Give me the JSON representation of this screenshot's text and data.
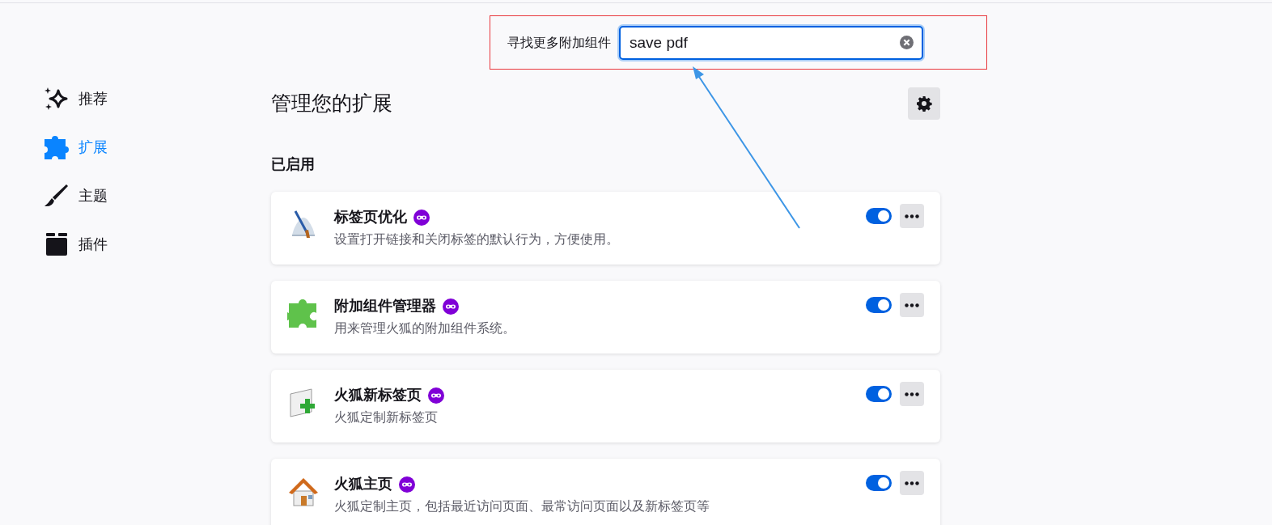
{
  "search": {
    "label": "寻找更多附加组件",
    "value": "save pdf"
  },
  "sidebar": {
    "items": [
      {
        "label": "推荐",
        "kind": "sparkle",
        "selected": false
      },
      {
        "label": "扩展",
        "kind": "puzzle",
        "selected": true
      },
      {
        "label": "主题",
        "kind": "brush",
        "selected": false
      },
      {
        "label": "插件",
        "kind": "block",
        "selected": false
      }
    ]
  },
  "heading": "管理您的扩展",
  "section": "已启用",
  "extensions": [
    {
      "name": "标签页优化",
      "description": "设置打开链接和关闭标签的默认行为，方便使用。",
      "kind": "brush",
      "on": true
    },
    {
      "name": "附加组件管理器",
      "description": "用来管理火狐的附加组件系统。",
      "kind": "puzzle",
      "on": true
    },
    {
      "name": "火狐新标签页",
      "description": "火狐定制新标签页",
      "kind": "page",
      "on": true
    },
    {
      "name": "火狐主页",
      "description": "火狐定制主页，包括最近访问页面、最常访问页面以及新标签页等",
      "kind": "house",
      "on": true
    }
  ]
}
